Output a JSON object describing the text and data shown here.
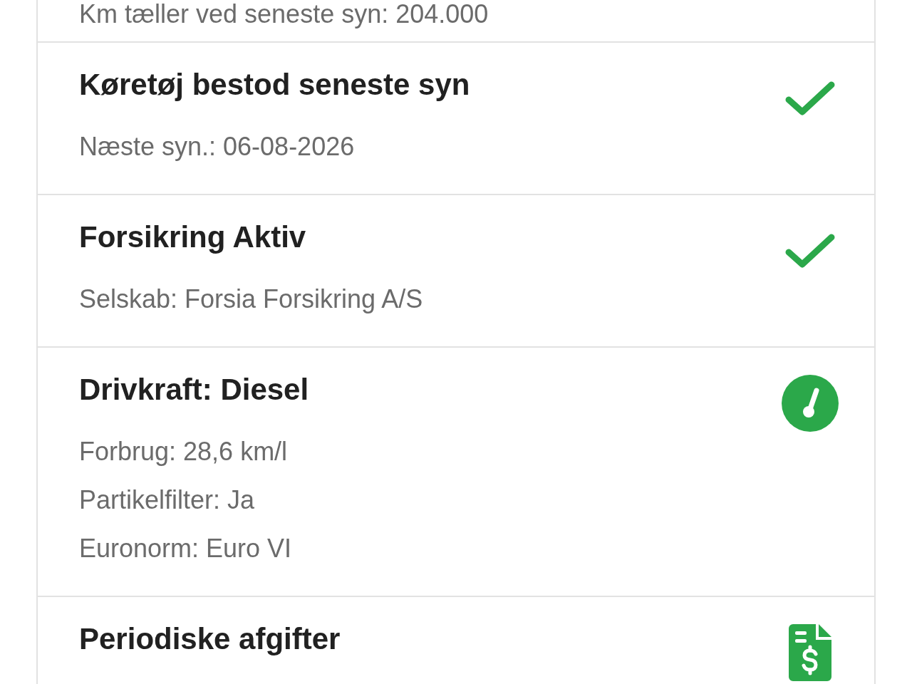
{
  "items": [
    {
      "lines": [
        "Km tæller ved seneste syn: 204.000"
      ]
    },
    {
      "title": "Køretøj bestod seneste syn",
      "kind": "check",
      "lines": [
        "Næste syn.: 06-08-2026"
      ]
    },
    {
      "title": "Forsikring Aktiv",
      "kind": "check",
      "lines": [
        "Selskab: Forsia Forsikring A/S"
      ]
    },
    {
      "title": "Drivkraft: Diesel",
      "kind": "gauge",
      "lines": [
        "Forbrug: 28,6 km/l",
        "Partikelfilter: Ja",
        "Euronorm: Euro VI"
      ]
    },
    {
      "title": "Periodiske afgifter",
      "kind": "invoice"
    }
  ]
}
